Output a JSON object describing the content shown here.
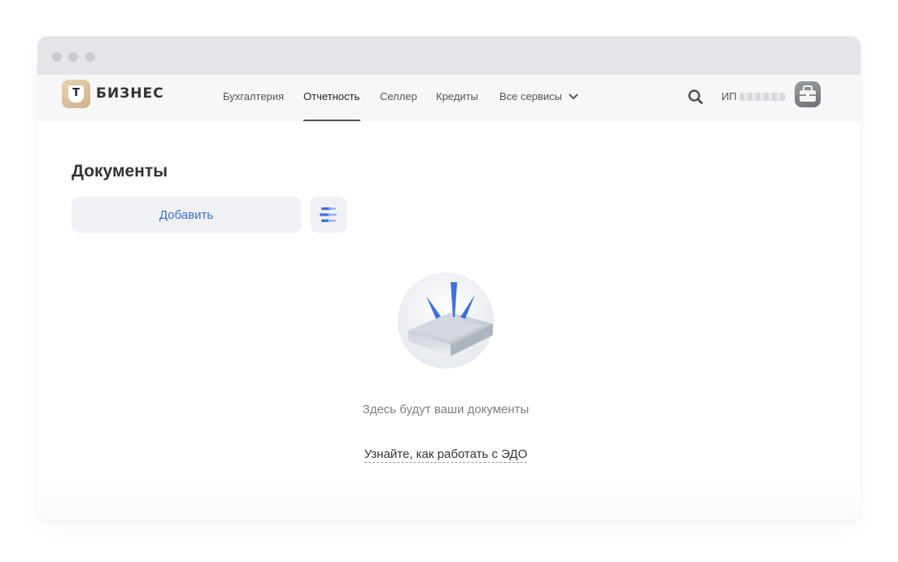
{
  "brand": {
    "logo_letter": "Т",
    "name": "БИЗНЕС"
  },
  "nav": {
    "items": [
      {
        "label": "Бухгалтерия"
      },
      {
        "label": "Отчетность",
        "active": true
      },
      {
        "label": "Селлер"
      },
      {
        "label": "Кредиты"
      },
      {
        "label": "Все сервисы"
      }
    ]
  },
  "user": {
    "prefix": "ИП"
  },
  "page": {
    "title": "Документы",
    "add_button_label": "Добавить"
  },
  "empty_state": {
    "message": "Здесь будут ваши документы",
    "link_label": "Узнайте, как работать с ЭДО"
  },
  "icons": {
    "search": "search-icon",
    "chevron": "chevron-down-icon",
    "filter": "filter-icon",
    "avatar": "briefcase-icon",
    "illustration": "empty-inbox-tray-icon"
  },
  "colors": {
    "accent": "#3f6fd8",
    "titlebar": "#e3e5e9",
    "navbar": "#f6f7f8",
    "button_bg": "#eff1f4",
    "logo_gold": "#d9be94"
  }
}
